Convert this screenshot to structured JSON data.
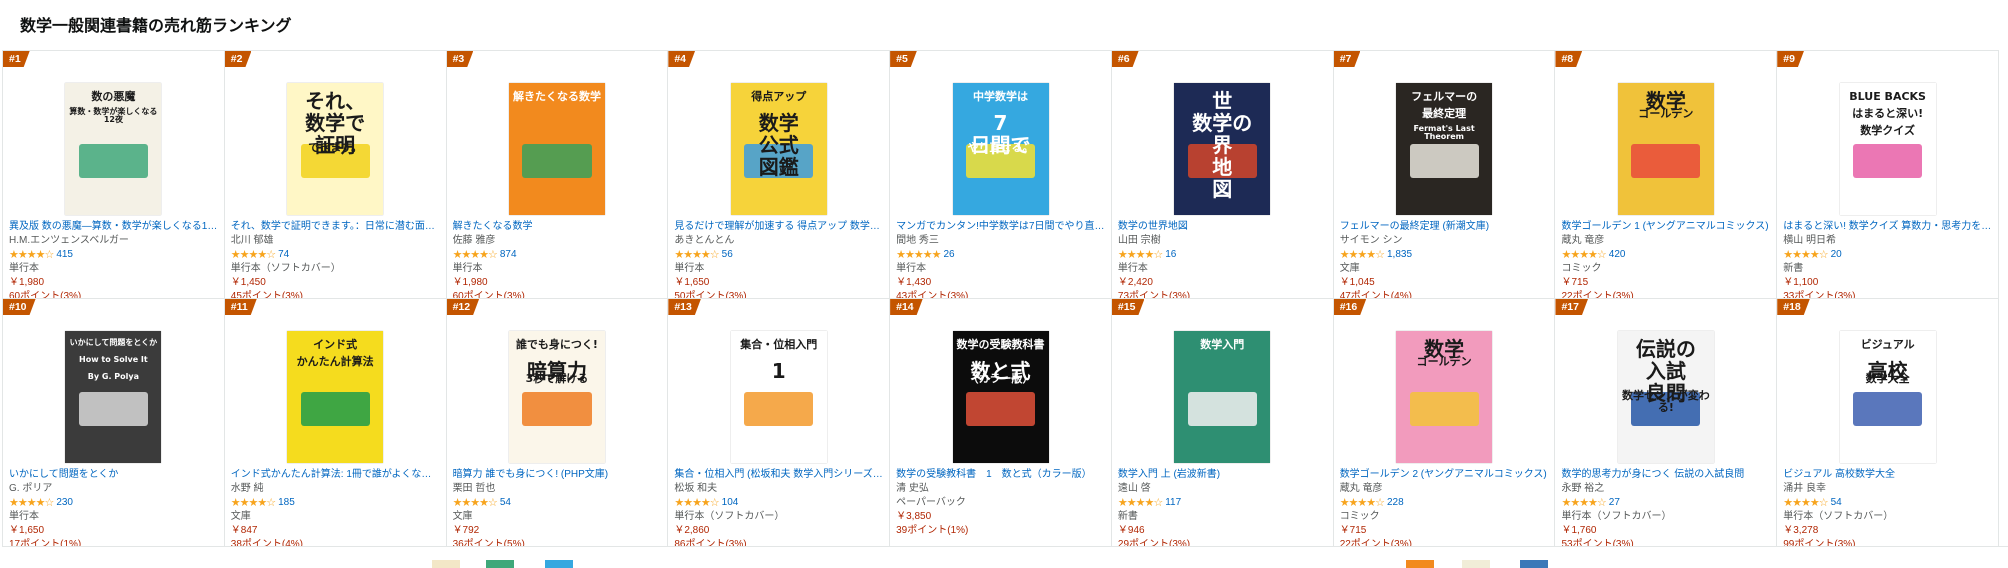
{
  "section_title": "数学一般関連書籍の売れ筋ランキング",
  "colors": {
    "badge": "#c45500",
    "link": "#0066c0",
    "price": "#b12704",
    "star": "#f7a41d"
  },
  "books": [
    {
      "rank": "#1",
      "title": "異及版 数の悪魔―算数・数学が楽しくなる1…",
      "author": "H.M.エンツェンスベルガー",
      "stars": "★★★★☆",
      "reviews": "415",
      "format": "単行本",
      "price": "￥1,980",
      "points": "60ポイント(3%)",
      "cover": {
        "bg": "#f4f1e6",
        "lines": [
          "数の悪魔",
          "算数・数学が楽しくなる12夜"
        ],
        "accent": "#3fa87a"
      }
    },
    {
      "rank": "#2",
      "title": "それ、数学で証明できます。：日常に潜む面…",
      "author": "北川 郁雄",
      "stars": "★★★★☆",
      "reviews": "74",
      "format": "単行本（ソフトカバー）",
      "price": "￥1,450",
      "points": "45ポイント(3%)",
      "cover": {
        "bg": "#fff7c6",
        "lines": [
          "それ、",
          "数学で",
          "証明",
          "できます。"
        ],
        "accent": "#f2d21b"
      }
    },
    {
      "rank": "#3",
      "title": "解きたくなる数学",
      "author": "佐藤 雅彦",
      "stars": "★★★★☆",
      "reviews": "874",
      "format": "単行本",
      "price": "￥1,980",
      "points": "60ポイント(3%)",
      "cover": {
        "bg": "#f28a1e",
        "lines": [
          "解きたくなる数学"
        ],
        "accent": "#3aa05a"
      }
    },
    {
      "rank": "#4",
      "title": "見るだけで理解が加速する 得点アップ 数学…",
      "author": "あきとんとん",
      "stars": "★★★★☆",
      "reviews": "56",
      "format": "単行本",
      "price": "￥1,650",
      "points": "50ポイント(3%)",
      "cover": {
        "bg": "#f6d33a",
        "lines": [
          "得点アップ",
          "数学",
          "公式",
          "図鑑"
        ],
        "accent": "#3b9be0"
      }
    },
    {
      "rank": "#5",
      "title": "マンガでカンタン!中学数学は7日間でやり直…",
      "author": "間地 秀三",
      "stars": "★★★★★",
      "reviews": "26",
      "format": "単行本",
      "price": "￥1,430",
      "points": "43ポイント(3%)",
      "cover": {
        "bg": "#35a8e0",
        "lines": [
          "中学数学は",
          "7",
          "日間で",
          "やり直せる。"
        ],
        "accent": "#f5e230"
      }
    },
    {
      "rank": "#6",
      "title": "数学の世界地図",
      "author": "山田 宗樹",
      "stars": "★★★★☆",
      "reviews": "16",
      "format": "単行本",
      "price": "￥2,420",
      "points": "73ポイント(3%)",
      "cover": {
        "bg": "#1d2a55",
        "lines": [
          "世",
          "数学の",
          "界",
          "地",
          "図"
        ],
        "accent": "#d4452a"
      }
    },
    {
      "rank": "#7",
      "title": "フェルマーの最終定理 (新潮文庫)",
      "author": "サイモン シン",
      "stars": "★★★★☆",
      "reviews": "1,835",
      "format": "文庫",
      "price": "￥1,045",
      "points": "47ポイント(4%)",
      "cover": {
        "bg": "#2a2622",
        "lines": [
          "フェルマーの",
          "最終定理",
          "Fermat's Last Theorem"
        ],
        "accent": "#e9e6dd"
      }
    },
    {
      "rank": "#8",
      "title": "数学ゴールデン 1 (ヤングアニマルコミックス)",
      "author": "蔵丸 竜彦",
      "stars": "★★★★☆",
      "reviews": "420",
      "format": "コミック",
      "price": "￥715",
      "points": "22ポイント(3%)",
      "cover": {
        "bg": "#f0c23a",
        "lines": [
          "数学",
          "ゴールデン"
        ],
        "accent": "#e94a3c"
      }
    },
    {
      "rank": "#9",
      "title": "はまると深い! 数学クイズ 算数力・思考力を…",
      "author": "横山 明日希",
      "stars": "★★★★☆",
      "reviews": "20",
      "format": "新書",
      "price": "￥1,100",
      "points": "33ポイント(3%)",
      "cover": {
        "bg": "#ffffff",
        "lines": [
          "BLUE BACKS",
          "はまると深い!",
          "数学クイズ"
        ],
        "accent": "#e85fa7"
      }
    },
    {
      "rank": "#10",
      "title": "いかにして問題をとくか",
      "author": "G. ポリア",
      "stars": "★★★★☆",
      "reviews": "230",
      "format": "単行本",
      "price": "￥1,650",
      "points": "17ポイント(1%)",
      "cover": {
        "bg": "#3b3b3b",
        "lines": [
          "いかにして問題をとくか",
          "How to Solve It",
          "By G. Polya"
        ],
        "accent": "#d9d9d9"
      }
    },
    {
      "rank": "#11",
      "title": "インド式かんたん計算法: 1冊で誰がよくな…",
      "author": "水野 純",
      "stars": "★★★★☆",
      "reviews": "185",
      "format": "文庫",
      "price": "￥847",
      "points": "38ポイント(4%)",
      "cover": {
        "bg": "#f5dc1e",
        "lines": [
          "インド式",
          "かんたん計算法"
        ],
        "accent": "#1f9c4a"
      }
    },
    {
      "rank": "#12",
      "title": "暗算力 誰でも身につく! (PHP文庫)",
      "author": "栗田 哲也",
      "stars": "★★★★☆",
      "reviews": "54",
      "format": "文庫",
      "price": "￥792",
      "points": "36ポイント(5%)",
      "cover": {
        "bg": "#fbf6ea",
        "lines": [
          "誰でも身につく!",
          "暗算力",
          "3秒で解ける"
        ],
        "accent": "#ee7d22"
      }
    },
    {
      "rank": "#13",
      "title": "集合・位相入門 (松坂和夫 数学入門シリーズ…",
      "author": "松坂 和夫",
      "stars": "★★★★☆",
      "reviews": "104",
      "format": "単行本（ソフトカバー）",
      "price": "￥2,860",
      "points": "86ポイント(3%)",
      "cover": {
        "bg": "#ffffff",
        "lines": [
          "集合・位相入門",
          "1"
        ],
        "accent": "#f39a2b"
      }
    },
    {
      "rank": "#14",
      "title": "数学の受験教科書　1　数と式（カラー版）",
      "author": "清 史弘",
      "stars": "",
      "reviews": "",
      "format": "ペーパーバック",
      "price": "￥3,850",
      "points": "39ポイント(1%)",
      "cover": {
        "bg": "#0c0c0c",
        "lines": [
          "数学の受験教科書",
          "数と式",
          "（カラー版）"
        ],
        "accent": "#e2513a"
      }
    },
    {
      "rank": "#15",
      "title": "数学入門 上 (岩波新書)",
      "author": "遠山 啓",
      "stars": "★★★★☆",
      "reviews": "117",
      "format": "新書",
      "price": "￥946",
      "points": "29ポイント(3%)",
      "cover": {
        "bg": "#2e8f72",
        "lines": [
          "数学入門"
        ],
        "accent": "#f1f1f1"
      }
    },
    {
      "rank": "#16",
      "title": "数学ゴールデン 2 (ヤングアニマルコミックス)",
      "author": "蔵丸 竜彦",
      "stars": "★★★★☆",
      "reviews": "228",
      "format": "コミック",
      "price": "￥715",
      "points": "22ポイント(3%)",
      "cover": {
        "bg": "#f29bbd",
        "lines": [
          "数学",
          "ゴールデン"
        ],
        "accent": "#f3c33a"
      }
    },
    {
      "rank": "#17",
      "title": "数学的思考力が身につく 伝説の入試良問",
      "author": "永野 裕之",
      "stars": "★★★★☆",
      "reviews": "27",
      "format": "単行本（ソフトカバー）",
      "price": "￥1,760",
      "points": "53ポイント(3%)",
      "cover": {
        "bg": "#f4f4f4",
        "lines": [
          "伝説の",
          "入試",
          "良問",
          "数学センスが変わる!"
        ],
        "accent": "#2456a6"
      }
    },
    {
      "rank": "#18",
      "title": "ビジュアル 高校数学大全",
      "author": "涌井 良幸",
      "stars": "★★★★☆",
      "reviews": "54",
      "format": "単行本（ソフトカバー）",
      "price": "￥3,278",
      "points": "99ポイント(3%)",
      "cover": {
        "bg": "#ffffff",
        "lines": [
          "ビジュアル",
          "高校",
          "数学大全"
        ],
        "accent": "#3d5fb0"
      }
    }
  ]
}
